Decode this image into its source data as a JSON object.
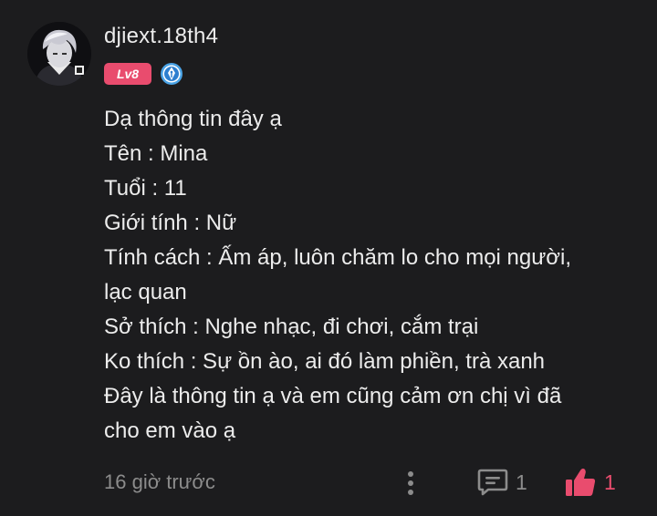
{
  "comment": {
    "username": "djiext.18th4",
    "level_badge": "Lv8",
    "body_lines": [
      "Dạ thông tin đây ạ",
      "Tên : Mina",
      "Tuổi : 11",
      "Giới tính : Nữ",
      "Tính cách : Ấm áp, luôn chăm lo cho mọi người,",
      "lạc quan",
      "Sở thích : Nghe nhạc, đi chơi, cắm trại",
      "Ko thích : Sự ồn ào, ai đó làm phiền, trà xanh",
      "Đây là thông tin ạ và em cũng cảm ơn chị vì đã",
      "cho em vào ạ"
    ],
    "timestamp": "16 giờ trước",
    "reply_count": "1",
    "like_count": "1"
  },
  "icons": {
    "avatar": "avatar-image",
    "badge": "pen-badge-icon",
    "more": "more-vertical-icon",
    "reply": "comment-bubble-icon",
    "like": "thumbs-up-icon"
  },
  "colors": {
    "background": "#1c1c1e",
    "text_primary": "#ececec",
    "text_muted": "#8c8c8c",
    "accent_pink": "#e94c6e",
    "badge_blue": "#4aa3e6"
  }
}
